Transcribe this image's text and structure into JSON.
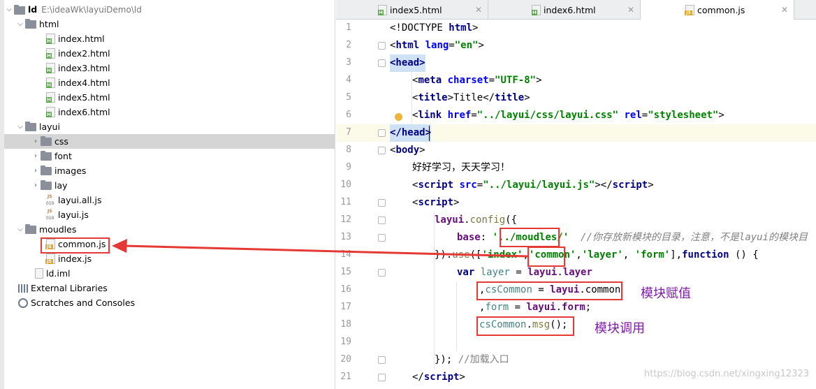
{
  "project": {
    "root_name": "ld",
    "root_path": "E:\\ideaWk\\layuiDemo\\ld",
    "items": [
      {
        "label": "html",
        "type": "folder"
      },
      {
        "label": "index.html",
        "type": "html"
      },
      {
        "label": "index2.html",
        "type": "html"
      },
      {
        "label": "index3.html",
        "type": "html"
      },
      {
        "label": "index4.html",
        "type": "html"
      },
      {
        "label": "index5.html",
        "type": "html"
      },
      {
        "label": "index6.html",
        "type": "html"
      },
      {
        "label": "layui",
        "type": "folder"
      },
      {
        "label": "css",
        "type": "folder"
      },
      {
        "label": "font",
        "type": "folder"
      },
      {
        "label": "images",
        "type": "folder"
      },
      {
        "label": "lay",
        "type": "folder"
      },
      {
        "label": "layui.all.js",
        "type": "jsbin"
      },
      {
        "label": "layui.js",
        "type": "jsbin"
      },
      {
        "label": "moudles",
        "type": "folder"
      },
      {
        "label": "common.js",
        "type": "js"
      },
      {
        "label": "index.js",
        "type": "js"
      },
      {
        "label": "ld.iml",
        "type": "iml"
      }
    ],
    "external_libraries": "External Libraries",
    "scratches": "Scratches and Consoles"
  },
  "tabs": [
    {
      "label": "index5.html"
    },
    {
      "label": "index6.html"
    },
    {
      "label": "common.js"
    }
  ],
  "line_numbers": [
    "1",
    "2",
    "3",
    "4",
    "5",
    "6",
    "7",
    "8",
    "9",
    "10",
    "11",
    "12",
    "13",
    "14",
    "15",
    "16",
    "17",
    "18",
    "19",
    "20",
    "21"
  ],
  "code": {
    "l1": {
      "lt": "<!DOCTYPE ",
      "kw": "html",
      "gt": ">"
    },
    "l2": {
      "open": "<",
      "tag": "html",
      "attr": "lang",
      "eq": "=",
      "val": "\"en\"",
      "close": ">"
    },
    "l3": {
      "text": "<head>"
    },
    "l4": {
      "open": "<",
      "tag": "meta",
      "attr": "charset",
      "eq": "=",
      "val": "\"UTF-8\"",
      "close": ">"
    },
    "l5": {
      "open": "<",
      "tag": "title",
      "gt": ">",
      "text": "Title",
      "close_open": "</",
      "close_tag": "title",
      "close": ">"
    },
    "l6": {
      "open": "<",
      "tag": "link",
      "attr1": "href",
      "eq1": "=",
      "val1": "\"../layui/css/layui.css\"",
      "attr2": "rel",
      "eq2": "=",
      "val2": "\"stylesheet\"",
      "close": ">"
    },
    "l7": {
      "text": "</head>"
    },
    "l8": {
      "open": "<",
      "tag": "body",
      "close": ">"
    },
    "l9": {
      "text": "好好学习，天天学习！"
    },
    "l10": {
      "open": "<",
      "tag": "script",
      "attr": "src",
      "eq": "=",
      "val": "\"../layui/layui.js\"",
      "gt": "></",
      "close_tag": "script",
      "close": ">"
    },
    "l11": {
      "open": "<",
      "tag": "script",
      "close": ">"
    },
    "l12": {
      "obj": "layui",
      "dot": ".",
      "fn": "config",
      "rest": "({"
    },
    "l13": {
      "key": "base",
      "colon": ": ",
      "q": "'",
      "val": "../moudles/",
      "q2": "'",
      "comment": "//你存放新模块的目录，注意，不是layui的模块目"
    },
    "l14": {
      "pre": "}).",
      "fn": "use",
      "b": "([",
      "m1": "'index'",
      "sep1": ",",
      "m2": "'common'",
      "sep2": ",",
      "m3": "'layer'",
      "sep3": ", ",
      "m4": "'form'",
      "post": "],",
      "kw": "function",
      "end": " () {"
    },
    "l15": {
      "kw": "var ",
      "v": "layer",
      "eq": " = ",
      "obj": "layui",
      "dot": ".",
      "prop": "layer"
    },
    "l16": {
      "comma": ",",
      "v": "csCommon",
      "eq": " = ",
      "obj": "layui",
      "dot": ".",
      "prop": "common"
    },
    "l17": {
      "comma": ",",
      "v": "form",
      "eq": " = ",
      "obj": "layui",
      "dot": ".",
      "prop": "form",
      "semi": ";"
    },
    "l18": {
      "v": "csCommon",
      "dot": ".",
      "fn": "msg",
      "rest": "();"
    },
    "l20": {
      "pre": "}); ",
      "comment": "//加载入口"
    },
    "l21": {
      "open": "</",
      "tag": "script",
      "close": ">"
    }
  },
  "annotations": {
    "assign": "模块赋值",
    "call": "模块调用"
  },
  "watermark": "https://blog.csdn.net/xingxing12323",
  "colors": {
    "highlight_box": "#e53935",
    "annotation_text": "#7b1fa2"
  }
}
